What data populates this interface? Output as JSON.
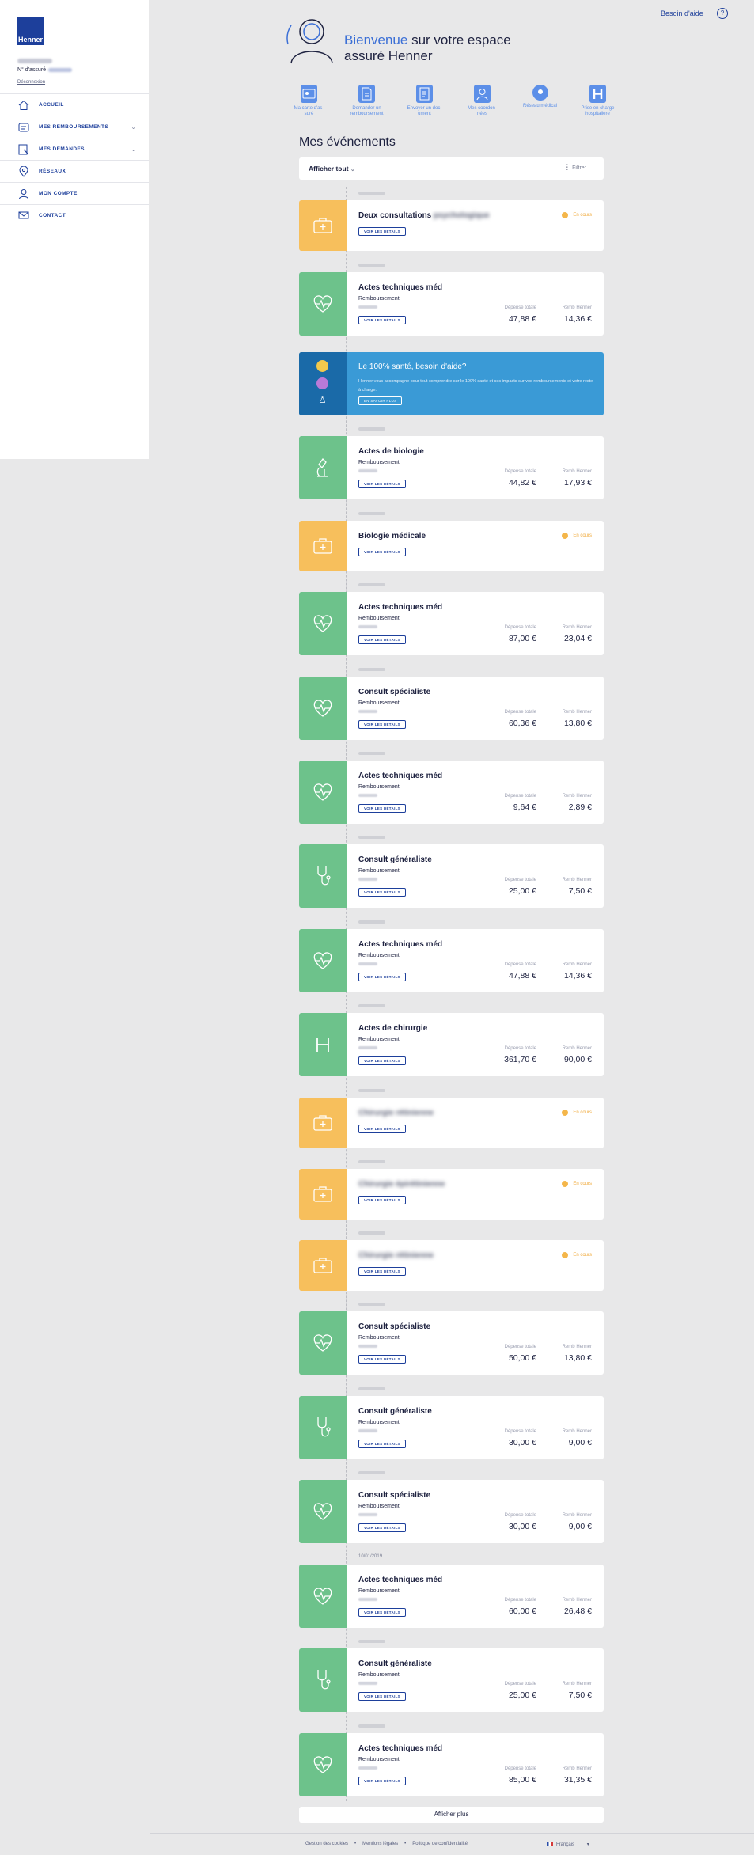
{
  "header": {
    "help_label": "Besoin d'aide",
    "help_icon": "?",
    "welcome_highlight": "Bienvenue",
    "welcome_rest_line1": "sur votre espace",
    "welcome_line2": "assuré Henner"
  },
  "sidebar": {
    "logo": "Henner",
    "member_label": "N° d'assuré",
    "logout": "Déconnexion",
    "items": [
      {
        "label": "ACCUEIL",
        "icon": "home-icon"
      },
      {
        "label": "MES REMBOURSEMENTS",
        "icon": "receipt-icon",
        "chevron": "⌄"
      },
      {
        "label": "MES DEMANDES",
        "icon": "request-icon",
        "chevron": "⌄"
      },
      {
        "label": "RÉSEAUX",
        "icon": "location-icon"
      },
      {
        "label": "MON COMPTE",
        "icon": "user-icon"
      },
      {
        "label": "CONTACT",
        "icon": "mail-icon"
      }
    ]
  },
  "quick_actions": [
    {
      "line1": "Ma carte d'as-",
      "line2": "suré",
      "icon": "card-icon"
    },
    {
      "line1": "Demander un",
      "line2": "remboursement",
      "icon": "document-icon"
    },
    {
      "line1": "Envoyer un doc-",
      "line2": "ument",
      "icon": "upload-icon"
    },
    {
      "line1": "Mes coordon-",
      "line2": "nées",
      "icon": "profile-icon"
    },
    {
      "line1": "Réseau médical",
      "line2": "",
      "icon": "pin-icon"
    },
    {
      "line1": "Prise en charge",
      "line2": "hospitalière",
      "icon": "hospital-icon"
    }
  ],
  "events": {
    "title": "Mes événements",
    "filter_select": "Afficher tout",
    "filter_label": "Filtrer",
    "details_label": "VOIR LES DÉTAILS",
    "spent_label": "Dépense totale",
    "reimb_label": "Remb Henner",
    "status_label": "En cours",
    "more_label": "Afficher plus",
    "visible_date": "10/01/2019",
    "items": [
      {
        "title": "Deux consultations",
        "title_blur": "psychologique",
        "kind": "orange"
      },
      {
        "title": "Actes techniques méd",
        "sub": "Remboursement",
        "spent": "47,88 €",
        "reimb": "14,36 €",
        "kind": "green"
      },
      {
        "title": "Actes de biologie",
        "sub": "Remboursement",
        "spent": "44,82 €",
        "reimb": "17,93 €",
        "kind": "green"
      },
      {
        "title": "Biologie médicale",
        "kind": "orange"
      },
      {
        "title": "Actes techniques méd",
        "sub": "Remboursement",
        "spent": "87,00 €",
        "reimb": "23,04 €",
        "kind": "green"
      },
      {
        "title": "Consult spécialiste",
        "sub": "Remboursement",
        "spent": "60,36 €",
        "reimb": "13,80 €",
        "kind": "green"
      },
      {
        "title": "Actes techniques méd",
        "sub": "Remboursement",
        "spent": "9,64 €",
        "reimb": "2,89 €",
        "kind": "green"
      },
      {
        "title": "Consult généraliste",
        "sub": "Remboursement",
        "spent": "25,00 €",
        "reimb": "7,50 €",
        "kind": "green"
      },
      {
        "title": "Actes techniques méd",
        "sub": "Remboursement",
        "spent": "47,88 €",
        "reimb": "14,36 €",
        "kind": "green"
      },
      {
        "title": "Actes de chirurgie",
        "sub": "Remboursement",
        "spent": "361,70 €",
        "reimb": "90,00 €",
        "kind": "green"
      },
      {
        "title": "",
        "title_blur": "Chirurgie rétinienne",
        "kind": "orange"
      },
      {
        "title": "",
        "title_blur": "Chirurgie épirétinienne",
        "kind": "orange"
      },
      {
        "title": "",
        "title_blur": "Chirurgie rétinienne",
        "kind": "orange"
      },
      {
        "title": "Consult spécialiste",
        "sub": "Remboursement",
        "spent": "50,00 €",
        "reimb": "13,80 €",
        "kind": "green"
      },
      {
        "title": "Consult généraliste",
        "sub": "Remboursement",
        "spent": "30,00 €",
        "reimb": "9,00 €",
        "kind": "green"
      },
      {
        "title": "Consult spécialiste",
        "sub": "Remboursement",
        "spent": "30,00 €",
        "reimb": "9,00 €",
        "kind": "green"
      },
      {
        "title": "Actes techniques méd",
        "sub": "Remboursement",
        "spent": "60,00 €",
        "reimb": "26,48 €",
        "kind": "green"
      },
      {
        "title": "Consult généraliste",
        "sub": "Remboursement",
        "spent": "25,00 €",
        "reimb": "7,50 €",
        "kind": "green"
      },
      {
        "title": "Actes techniques méd",
        "sub": "Remboursement",
        "spent": "85,00 €",
        "reimb": "31,35 €",
        "kind": "green"
      }
    ]
  },
  "promo": {
    "title": "Le 100% santé, besoin d'aide?",
    "text": "Henner vous accompagne pour tout comprendre sur le 100% santé et ses impacts sur vos remboursements et votre reste à charge.",
    "button": "EN SAVOIR PLUS"
  },
  "footer": {
    "links": [
      "Gestion des cookies",
      "•",
      "Mentions légales",
      "•",
      "Politique de confidentialité"
    ],
    "language": "Français"
  },
  "colors": {
    "brand": "#1d3f9b",
    "accent": "#3b6fd6",
    "green": "#6dc28b",
    "orange": "#f7bf5c",
    "promo": "#3a9ad6"
  }
}
